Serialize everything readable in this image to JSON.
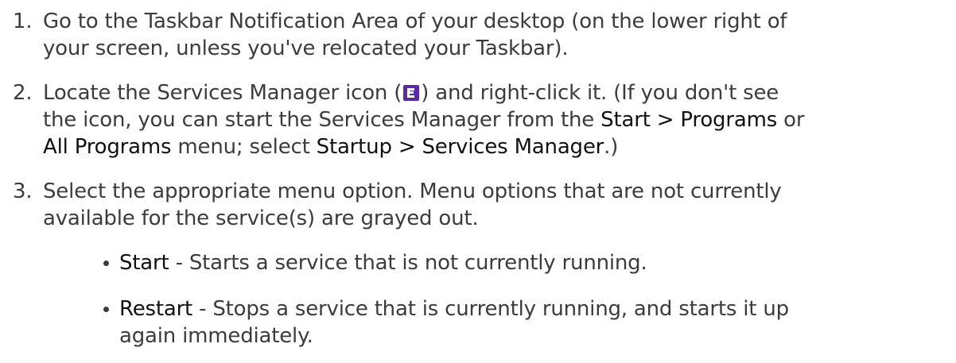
{
  "steps": [
    {
      "number": "1.",
      "lines": [
        "Go to the Taskbar Notification Area of your desktop (on the lower right of",
        "your screen, unless you've relocated your Taskbar)."
      ]
    },
    {
      "number": "2.",
      "line1_pre": "Locate the Services Manager icon (",
      "line1_post": ") and right-click it. (If you don't see",
      "line2_pre": "the icon, you can start the Services Manager from the ",
      "line2_bold": "Start > Programs",
      "line2_post": " or",
      "line3_bold1": "All Programs",
      "line3_mid": " menu; select ",
      "line3_bold2": "Startup > Services Manager",
      "line3_post": ".)",
      "icon": "services-manager-icon",
      "icon_color": "#5b2ca0"
    },
    {
      "number": "3.",
      "lines": [
        "Select the appropriate menu option. Menu options that are not currently",
        "available for the service(s) are grayed out."
      ]
    }
  ],
  "bullets": [
    {
      "term": "Start",
      "desc_lines": [
        " - Starts a service that is not currently running."
      ]
    },
    {
      "term": "Restart",
      "desc_lines": [
        " - Stops a service that is currently running, and starts it up",
        "again immediately."
      ]
    }
  ]
}
